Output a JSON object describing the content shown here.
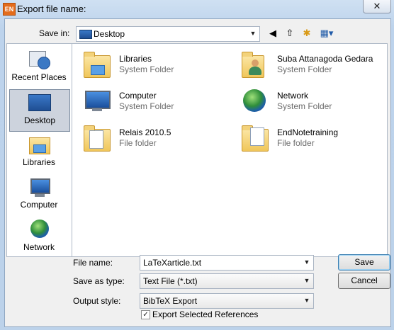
{
  "window": {
    "title": "Export file name:",
    "app_icon": "EN",
    "close_glyph": "✕"
  },
  "save_in": {
    "label": "Save in:",
    "value": "Desktop"
  },
  "toolbar": {
    "back_glyph": "◀",
    "up_glyph": "⇧",
    "new_folder_glyph": "✱",
    "views_glyph": "▦▾"
  },
  "places": [
    {
      "label": "Recent Places",
      "icon": "recent-places-icon"
    },
    {
      "label": "Desktop",
      "icon": "desktop-icon"
    },
    {
      "label": "Libraries",
      "icon": "libraries-icon"
    },
    {
      "label": "Computer",
      "icon": "computer-icon"
    },
    {
      "label": "Network",
      "icon": "network-icon"
    }
  ],
  "items": [
    {
      "name": "Libraries",
      "type": "System Folder",
      "icon": "libraries-folder-icon"
    },
    {
      "name": "Suba Attanagoda Gedara",
      "type": "System Folder",
      "icon": "user-folder-icon"
    },
    {
      "name": "Computer",
      "type": "System Folder",
      "icon": "computer-icon"
    },
    {
      "name": "Network",
      "type": "System Folder",
      "icon": "network-icon"
    },
    {
      "name": "Relais 2010.5",
      "type": "File folder",
      "icon": "folder-icon"
    },
    {
      "name": "EndNotetraining",
      "type": "File folder",
      "icon": "folder-icon"
    }
  ],
  "form": {
    "file_name_label": "File name:",
    "file_name_value": "LaTeXarticle.txt",
    "save_as_label": "Save as type:",
    "save_as_value": "Text File (*.txt)",
    "output_style_label": "Output style:",
    "output_style_value": "BibTeX Export",
    "export_selected_label": "Export Selected References",
    "export_selected_checked": "✓"
  },
  "buttons": {
    "save": "Save",
    "cancel": "Cancel"
  }
}
